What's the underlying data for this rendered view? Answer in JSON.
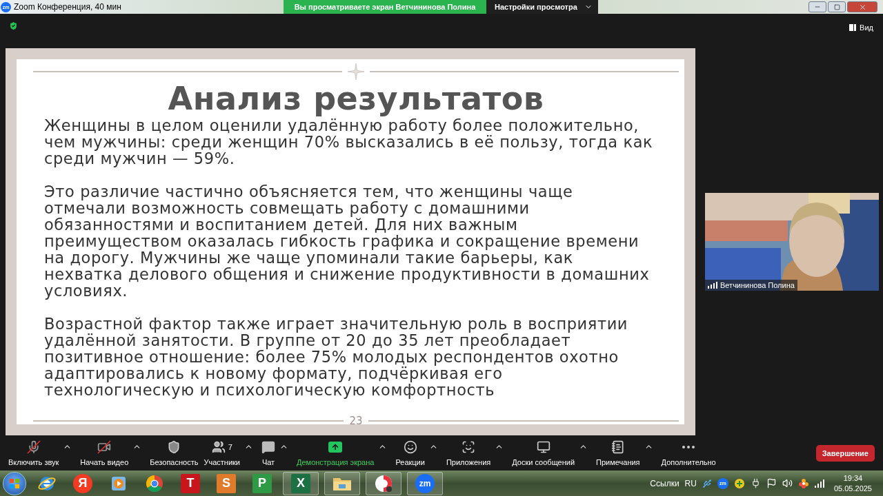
{
  "window": {
    "logo": "zm",
    "title": "Zoom Конференция, 40 мин"
  },
  "share_banner": {
    "text": "Вы просматриваете экран Ветчининова Полина",
    "settings": "Настройки просмотра"
  },
  "view_button": "Вид",
  "slide": {
    "title": "Анализ результатов",
    "paragraphs": [
      "Женщины в целом оценили удалённую работу более положительно, чем мужчины: среди женщин 70% высказались в её пользу, тогда как среди мужчин — 59%.",
      "Это различие частично объясняется тем, что женщины чаще отмечали возможность совмещать работу с домашними обязанностями и воспитанием детей. Для них важным преимуществом оказалась гибкость графика и сокращение времени на дорогу. Мужчины же чаще упоминали такие барьеры, как нехватка делового общения и снижение продуктивности в домашних условиях.",
      "Возрастной фактор также играет значительную роль в восприятии удалённой занятости. В группе от 20 до 35 лет преобладает позитивное отношение: более 75% молодых респондентов охотно адаптировались к новому формату, подчёркивая его технологическую и психологическую комфортность"
    ],
    "page": "23"
  },
  "video": {
    "name": "Ветчининова Полина"
  },
  "toolbar": {
    "items": [
      {
        "kind": "audio",
        "label": "Включить звук",
        "off": true,
        "caret": true,
        "active": false
      },
      {
        "kind": "video",
        "label": "Начать видео",
        "off": true,
        "caret": true,
        "active": false
      },
      {
        "kind": "security",
        "label": "Безопасность",
        "caret": false,
        "active": false
      },
      {
        "kind": "participants",
        "label": "Участники",
        "count": "7",
        "caret": true,
        "active": false
      },
      {
        "kind": "chat",
        "label": "Чат",
        "caret": true,
        "active": false
      },
      {
        "kind": "share",
        "label": "Демонстрация экрана",
        "caret": true,
        "active": true
      },
      {
        "kind": "reactions",
        "label": "Реакции",
        "caret": true,
        "active": false
      },
      {
        "kind": "apps",
        "label": "Приложения",
        "caret": true,
        "active": false
      },
      {
        "kind": "boards",
        "label": "Доски сообщений",
        "caret": true,
        "active": false
      },
      {
        "kind": "notes",
        "label": "Примечания",
        "caret": true,
        "active": false
      },
      {
        "kind": "more",
        "label": "Дополнительно",
        "caret": false,
        "active": false
      }
    ],
    "end_button": "Завершение"
  },
  "taskbar": {
    "apps": [
      {
        "kind": "browser-e"
      },
      {
        "kind": "letter",
        "text": "Я",
        "color": "#f33a22",
        "round": true
      },
      {
        "kind": "player"
      },
      {
        "kind": "chrome"
      },
      {
        "kind": "letter",
        "text": "T",
        "color": "#c8161d",
        "round": false
      },
      {
        "kind": "letter",
        "text": "S",
        "color": "#e07b2c",
        "round": false
      },
      {
        "kind": "letter",
        "text": "P",
        "color": "#2f9a45",
        "round": false
      },
      {
        "kind": "letter",
        "text": "X",
        "color": "#1d7044",
        "round": false
      },
      {
        "kind": "folder"
      },
      {
        "kind": "yabrowser"
      },
      {
        "kind": "letter",
        "text": "zm",
        "color": "#1a6ef5",
        "round": true
      }
    ],
    "links": "Ссылки",
    "lang": "RU",
    "tray_logo": "zm",
    "time": "19:34",
    "date": "05.05.2025"
  }
}
